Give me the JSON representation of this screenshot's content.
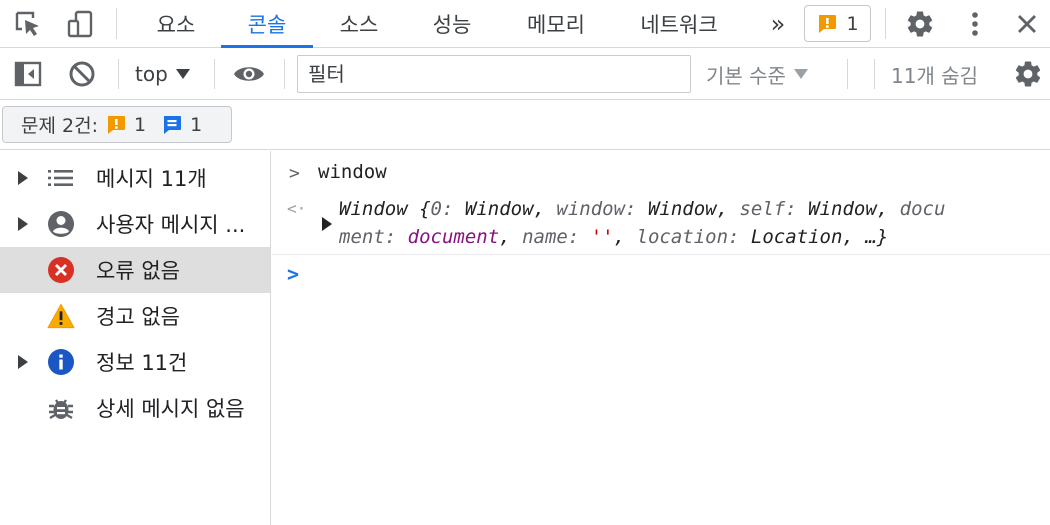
{
  "tabs": [
    {
      "label": "요소"
    },
    {
      "label": "콘솔"
    },
    {
      "label": "소스"
    },
    {
      "label": "성능"
    },
    {
      "label": "메모리"
    },
    {
      "label": "네트워크"
    }
  ],
  "issue_badge": {
    "count": "1"
  },
  "toolbar": {
    "context": "top",
    "filter_placeholder": "필터",
    "levels": "기본 수준",
    "hidden": "11개 숨김"
  },
  "issues_bar": {
    "label": "문제 2건:",
    "warn_count": "1",
    "info_count": "1"
  },
  "sidebar": {
    "items": [
      {
        "label": "메시지 11개",
        "icon": "list-icon",
        "expandable": true
      },
      {
        "label": "사용자 메시지 ...",
        "icon": "user-icon",
        "expandable": true
      },
      {
        "label": "오류 없음",
        "icon": "error-icon",
        "expandable": false,
        "selected": true
      },
      {
        "label": "경고 없음",
        "icon": "warning-icon",
        "expandable": false
      },
      {
        "label": "정보 11건",
        "icon": "info-icon",
        "expandable": true
      },
      {
        "label": "상세 메시지 없음",
        "icon": "bug-icon",
        "expandable": false
      }
    ]
  },
  "console": {
    "command": "window",
    "result": {
      "class_name": "Window",
      "k0": "0",
      "v0": "Window",
      "k1": "window",
      "v1": "Window",
      "k2": "self",
      "v2": "Window",
      "k3_part1": "docu",
      "k3_part2": "ment",
      "v3": "document",
      "k4": "name",
      "v4": "''",
      "k5": "location",
      "v5": "Location",
      "ellipsis": "…"
    }
  },
  "colors": {
    "accent": "#1a73e8",
    "warning": "#f29900",
    "error": "#d93025",
    "info": "#1a73e8"
  }
}
